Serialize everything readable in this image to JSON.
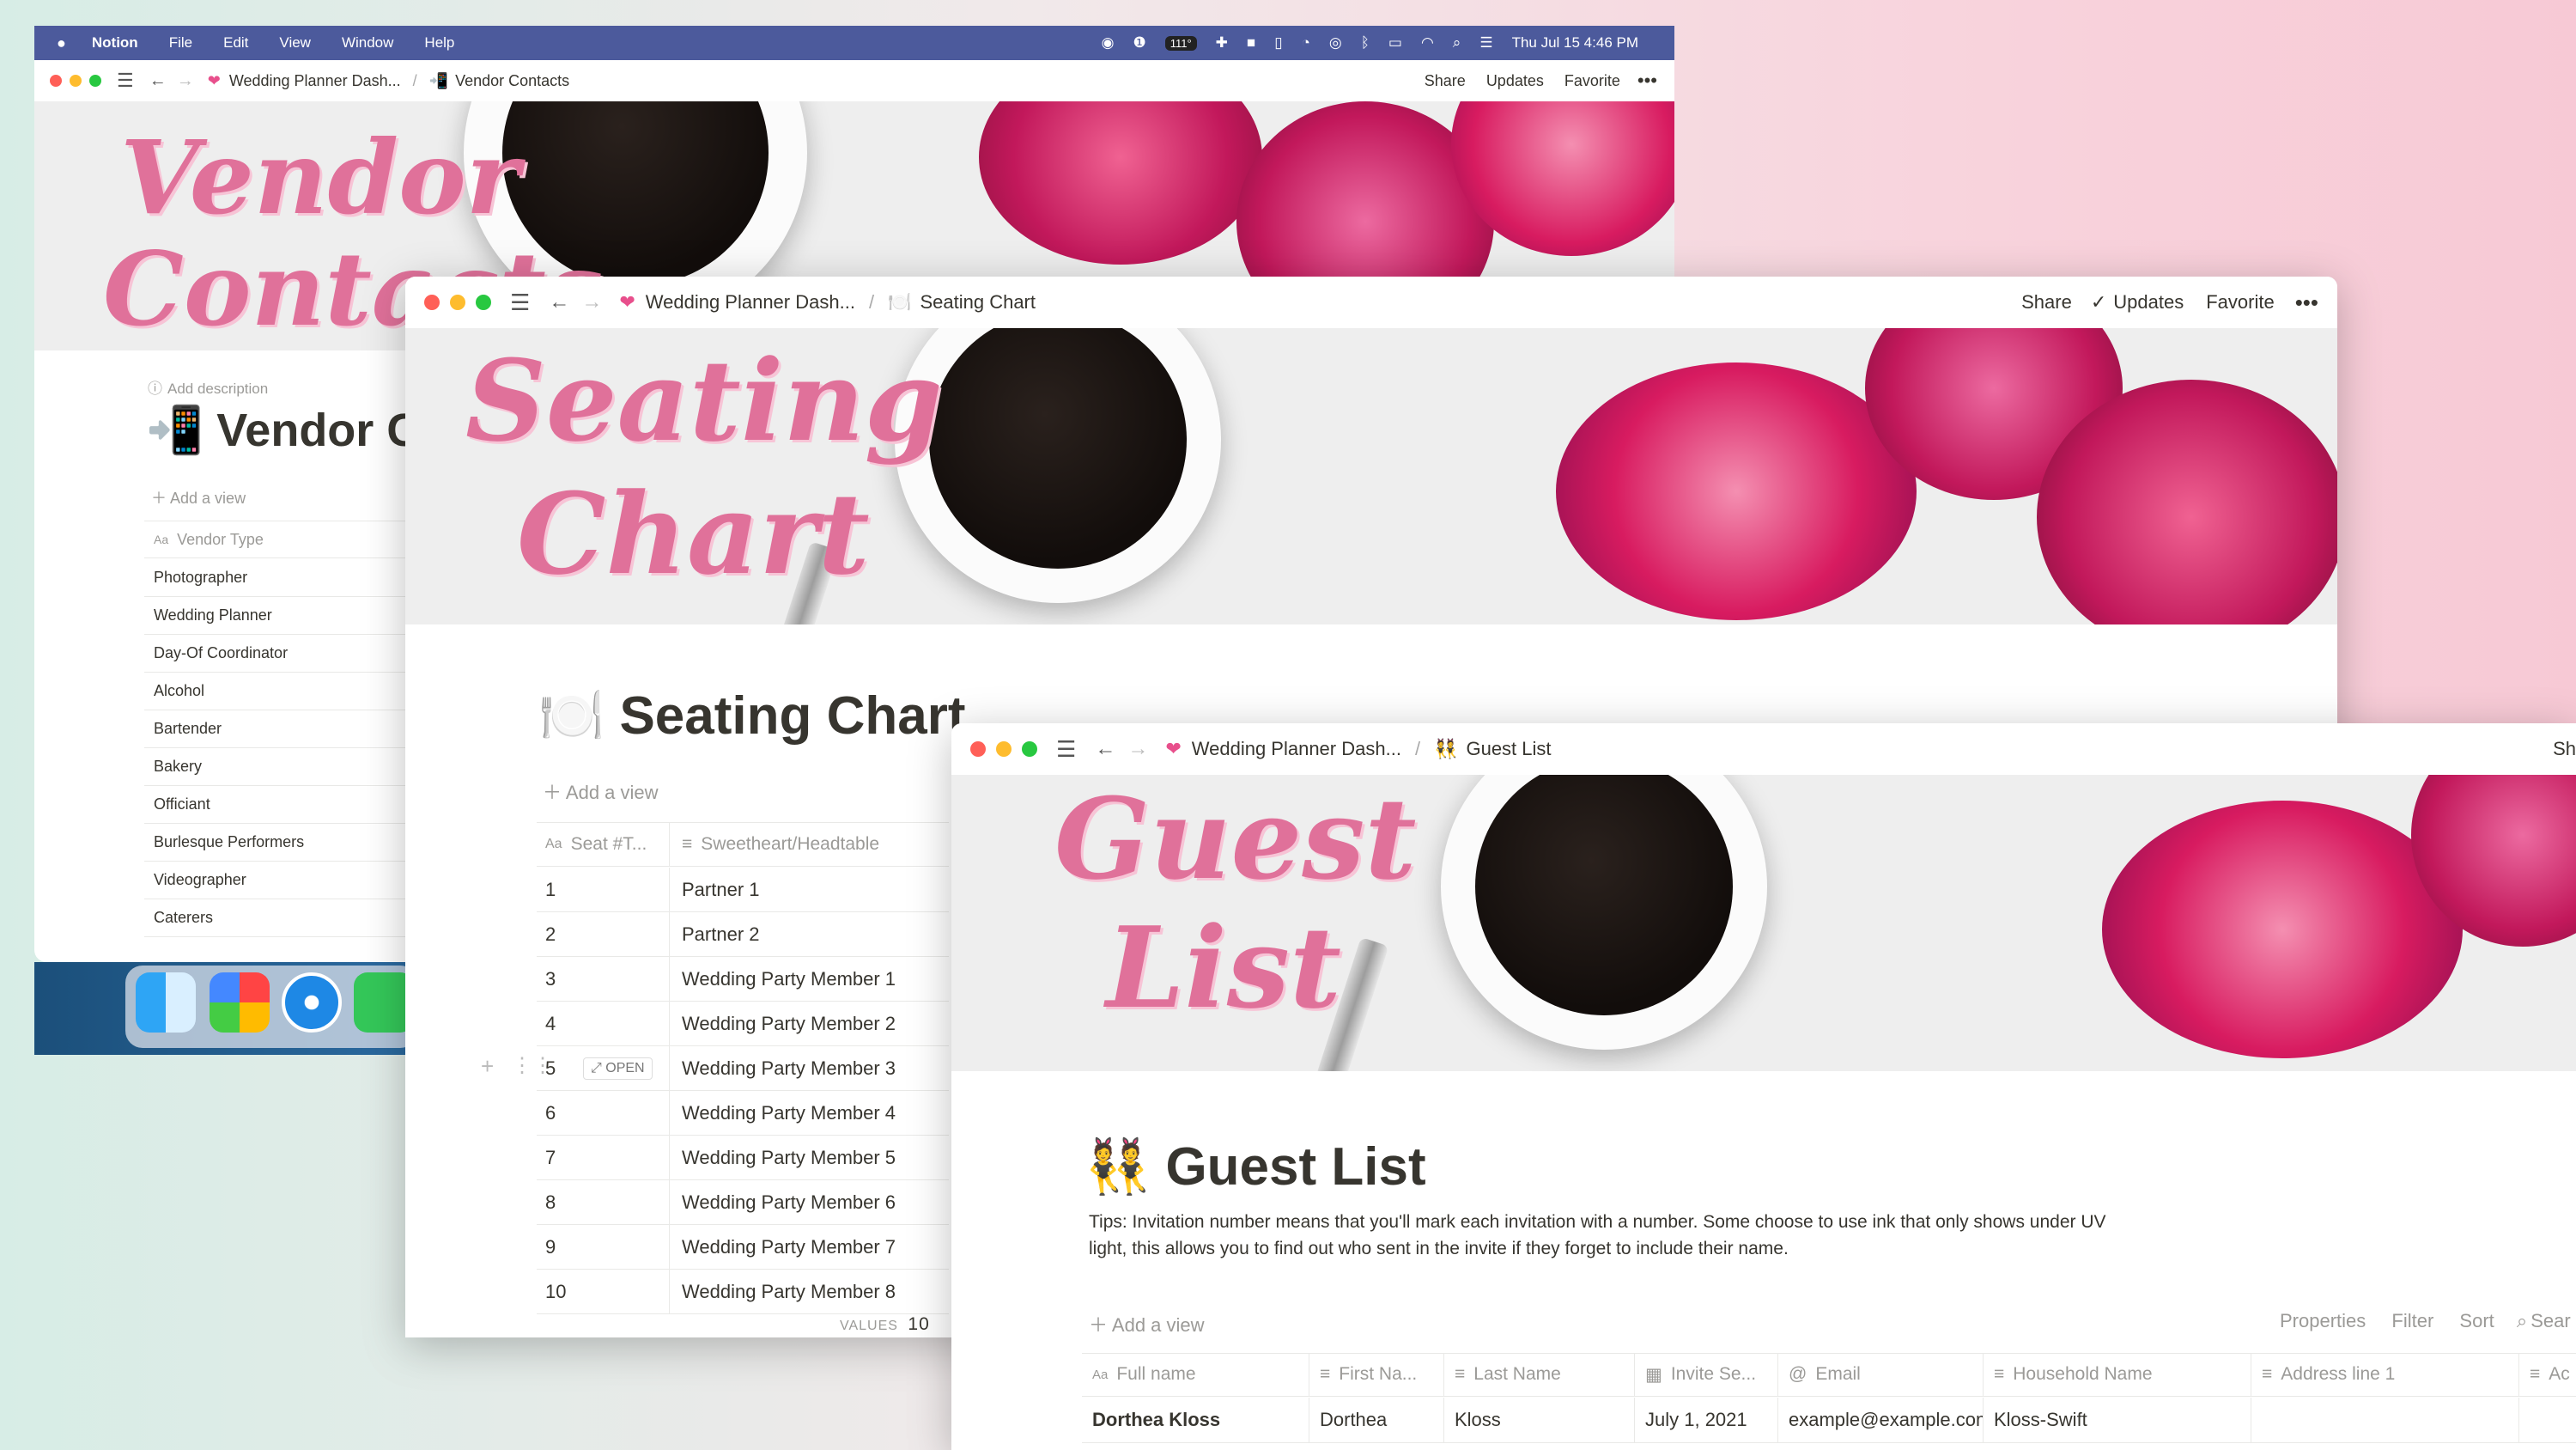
{
  "menubar": {
    "app": "Notion",
    "items": [
      "File",
      "Edit",
      "View",
      "Window",
      "Help"
    ],
    "status_battery": "111°",
    "clock": "Thu Jul 15  4:46 PM"
  },
  "vendor_window": {
    "crumb_parent": "Wedding Planner Dash...",
    "crumb_page": "Vendor Contacts",
    "share": "Share",
    "updates": "Updates",
    "favorite": "Favorite",
    "banner_line1": "Vendor",
    "banner_line2": "Contacts",
    "add_description": "Add description",
    "title": "Vendor Co",
    "title_icon": "📲",
    "add_view": "Add a view",
    "column_header": "Vendor Type",
    "rows": [
      "Photographer",
      "Wedding Planner",
      "Day-Of Coordinator",
      "Alcohol",
      "Bartender",
      "Bakery",
      "Officiant",
      "Burlesque Performers",
      "Videographer",
      "Caterers"
    ]
  },
  "seating_window": {
    "crumb_parent": "Wedding Planner Dash...",
    "crumb_page": "Seating Chart",
    "share": "Share",
    "updates": "Updates",
    "favorite": "Favorite",
    "banner_line1": "Seating",
    "banner_line2": "Chart",
    "title": "Seating Chart",
    "title_icon": "🍽️",
    "add_view": "Add a view",
    "col1": "Seat #T...",
    "col2": "Sweetheart/Headtable",
    "open_label": "OPEN",
    "rows": [
      {
        "n": "1",
        "v": "Partner 1"
      },
      {
        "n": "2",
        "v": "Partner 2"
      },
      {
        "n": "3",
        "v": "Wedding Party Member 1"
      },
      {
        "n": "4",
        "v": "Wedding Party Member 2"
      },
      {
        "n": "5",
        "v": "Wedding Party Member 3"
      },
      {
        "n": "6",
        "v": "Wedding Party Member 4"
      },
      {
        "n": "7",
        "v": "Wedding Party Member 5"
      },
      {
        "n": "8",
        "v": "Wedding Party Member 6"
      },
      {
        "n": "9",
        "v": "Wedding Party Member 7"
      },
      {
        "n": "10",
        "v": "Wedding Party Member 8"
      }
    ],
    "values_label": "VALUES",
    "values_count": "10"
  },
  "guest_window": {
    "crumb_parent": "Wedding Planner Dash...",
    "crumb_page": "Guest List",
    "share_partial": "Sh",
    "banner_line1": "Guest",
    "banner_line2": "List",
    "title": "Guest List",
    "title_icon": "👯",
    "tips": "Tips: Invitation number means that you'll mark each invitation with a number. Some choose to use ink that only shows under UV light, this allows you to find out who sent in the invite if they forget to include their name.",
    "add_view": "Add a view",
    "properties": "Properties",
    "filter": "Filter",
    "sort": "Sort",
    "search": "Sear",
    "headers": [
      "Full name",
      "First Na...",
      "Last Name",
      "Invite Se...",
      "Email",
      "Household Name",
      "Address line 1",
      "Ac"
    ],
    "row": [
      "Dorthea Kloss",
      "Dorthea",
      "Kloss",
      "July 1, 2021",
      "example@example.com",
      "Kloss-Swift",
      "",
      ""
    ]
  },
  "colors": {
    "menubar": "#4c5a9c",
    "script_pink": "#e0719a",
    "rose": "#c2185b",
    "text": "#37352f",
    "muted": "#9b9a97"
  }
}
